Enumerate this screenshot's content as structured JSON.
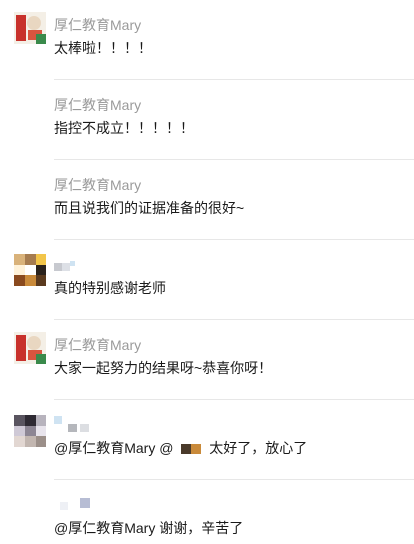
{
  "comments": [
    {
      "name": "厚仁教育Mary",
      "text": "太棒啦！！！！",
      "avatar": "organization-logo-avatar"
    },
    {
      "name": "厚仁教育Mary",
      "text": "指控不成立！！！！！",
      "avatar": ""
    },
    {
      "name": "厚仁教育Mary",
      "text": "而且说我们的证据准备的很好~",
      "avatar": ""
    },
    {
      "name": "",
      "text": "真的特别感谢老师",
      "avatar": "pixelated-user-avatar"
    },
    {
      "name": "厚仁教育Mary",
      "text": "大家一起努力的结果呀~恭喜你呀！",
      "avatar": "organization-logo-avatar"
    },
    {
      "name": "",
      "text_prefix": "@厚仁教育Mary @",
      "text_suffix": "太好了，放心了",
      "avatar": "pixelated-user-avatar"
    },
    {
      "name": "",
      "text": "@厚仁教育Mary 谢谢，辛苦了",
      "avatar": ""
    }
  ],
  "colors": {
    "name": "#9a9a9a",
    "text": "#1a1a1a",
    "divider": "#e7e7e7",
    "logo_red": "#c8312b",
    "logo_green": "#3a8a4b"
  }
}
